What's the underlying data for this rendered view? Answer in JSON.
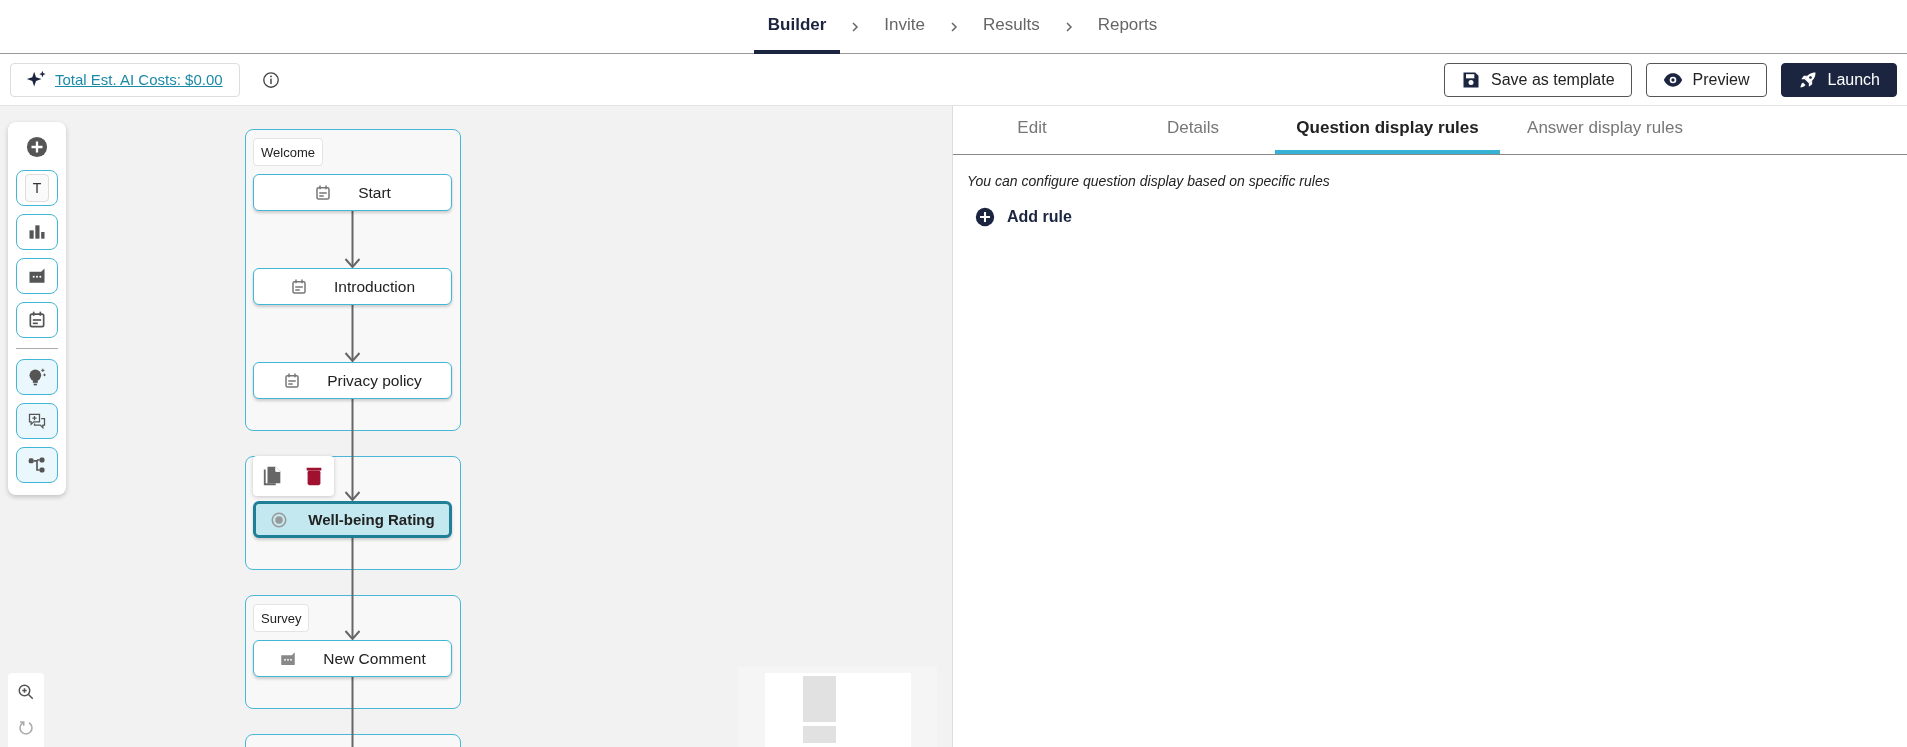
{
  "nav": {
    "steps": [
      {
        "label": "Builder",
        "selected": true
      },
      {
        "label": "Invite",
        "selected": false
      },
      {
        "label": "Results",
        "selected": false
      },
      {
        "label": "Reports",
        "selected": false
      }
    ]
  },
  "toolbar": {
    "ai_costs": "Total Est. AI Costs: $0.00",
    "buttons": [
      {
        "kind": "save",
        "label": "Save as template"
      },
      {
        "kind": "preview",
        "label": "Preview"
      },
      {
        "kind": "launch",
        "label": "Launch"
      }
    ]
  },
  "canvas": {
    "tools": [
      {
        "kind": "text",
        "label": "T"
      },
      {
        "kind": "chart"
      },
      {
        "kind": "comment"
      },
      {
        "kind": "calendar"
      },
      {
        "kind": "bulb"
      },
      {
        "kind": "chat"
      },
      {
        "kind": "tree"
      }
    ],
    "groups": [
      {
        "kind": "full",
        "label": "Welcome",
        "nodes": [
          {
            "kind": "calendar",
            "label": "Start",
            "selected": false
          },
          {
            "kind": "calendar",
            "label": "Introduction",
            "selected": false
          },
          {
            "kind": "calendar",
            "label": "Privacy policy",
            "selected": false
          }
        ]
      },
      {
        "kind": "full",
        "actions_open": true,
        "nodes": [
          {
            "kind": "radio",
            "label": "Well-being Rating",
            "selected": true
          }
        ]
      },
      {
        "kind": "full",
        "label": "Survey",
        "nodes": [
          {
            "kind": "comment",
            "label": "New Comment",
            "selected": false
          }
        ]
      },
      {
        "kind": "clipped"
      }
    ]
  },
  "panel": {
    "tabs": [
      {
        "label": "Edit",
        "selected": false
      },
      {
        "label": "Details",
        "selected": false
      },
      {
        "label": "Question display rules",
        "selected": true
      },
      {
        "label": "Answer display rules",
        "selected": false
      }
    ],
    "hint": "You can configure question display based on specific rules",
    "add_rule": "Add rule"
  }
}
